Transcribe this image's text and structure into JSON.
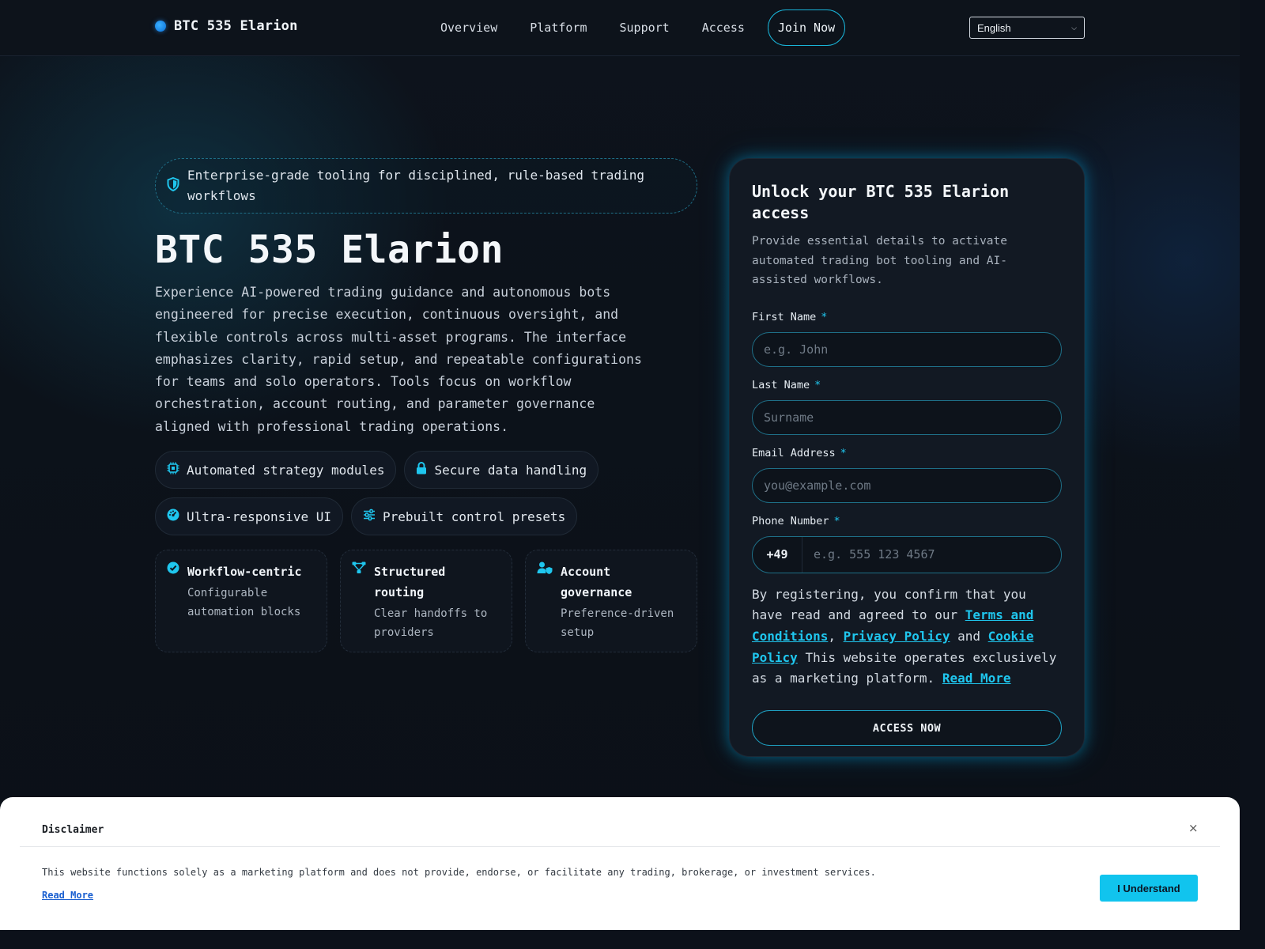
{
  "header": {
    "brand": "BTC 535 Elarion",
    "nav": [
      "Overview",
      "Platform",
      "Support",
      "Access"
    ],
    "join": "Join Now",
    "language": "English"
  },
  "hero": {
    "badge": "Enterprise-grade tooling for disciplined, rule-based trading workflows",
    "title": "BTC 535 Elarion",
    "description": "Experience AI-powered trading guidance and autonomous bots engineered for precise execution, continuous oversight, and flexible controls across multi-asset programs. The interface emphasizes clarity, rapid setup, and repeatable configurations for teams and solo operators. Tools focus on workflow orchestration, account routing, and parameter governance aligned with professional trading operations.",
    "chips": [
      {
        "icon": "chip-icon",
        "label": "Automated strategy modules"
      },
      {
        "icon": "lock-icon",
        "label": "Secure data handling"
      },
      {
        "icon": "gauge-icon",
        "label": "Ultra-responsive UI"
      },
      {
        "icon": "sliders-icon",
        "label": "Prebuilt control presets"
      }
    ],
    "cards": [
      {
        "icon": "check-circle-icon",
        "title": "Workflow-centric",
        "subtitle": "Configurable automation blocks"
      },
      {
        "icon": "routing-icon",
        "title": "Structured routing",
        "subtitle": "Clear handoffs to providers"
      },
      {
        "icon": "user-shield-icon",
        "title": "Account governance",
        "subtitle": "Preference-driven setup"
      }
    ]
  },
  "form": {
    "title": "Unlock your BTC 535 Elarion access",
    "subtitle": "Provide essential details to activate automated trading bot tooling and AI-assisted workflows.",
    "required_mark": "*",
    "first_name": {
      "label": "First Name",
      "placeholder": "e.g. John"
    },
    "last_name": {
      "label": "Last Name",
      "placeholder": "Surname"
    },
    "email": {
      "label": "Email Address",
      "placeholder": "you@example.com"
    },
    "phone": {
      "label": "Phone Number",
      "code": "+49",
      "placeholder": "e.g. 555 123 4567"
    },
    "consent": {
      "intro": "By registering, you confirm that you have read and agreed to our",
      "terms": "Terms and Conditions",
      "comma": ",",
      "privacy": "Privacy Policy",
      "and": "and",
      "cookie": "Cookie Policy",
      "tail": "This website operates exclusively as a marketing platform.",
      "read_more": "Read More"
    },
    "submit": "ACCESS NOW"
  },
  "disclaimer": {
    "title": "Disclaimer",
    "close": "×",
    "text": "This website functions solely as a marketing platform and does not provide, endorse, or facilitate any trading, brokerage, or investment services.",
    "read_more": "Read More",
    "button": "I Understand"
  },
  "colors": {
    "accent": "#1fc6ee",
    "background": "#0c111a",
    "card": "#121923"
  }
}
